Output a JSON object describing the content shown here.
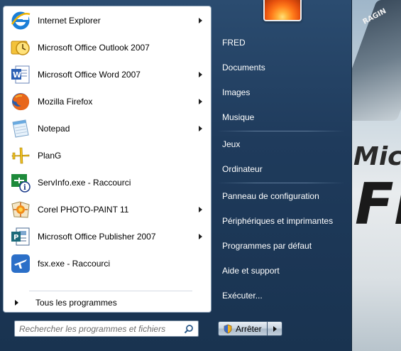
{
  "programs": [
    {
      "label": "Internet Explorer",
      "icon": "internet-explorer-icon",
      "has_arrow": true
    },
    {
      "label": "Microsoft Office Outlook 2007",
      "icon": "outlook-icon",
      "has_arrow": false
    },
    {
      "label": "Microsoft Office Word 2007",
      "icon": "word-icon",
      "has_arrow": true
    },
    {
      "label": "Mozilla Firefox",
      "icon": "firefox-icon",
      "has_arrow": true
    },
    {
      "label": "Notepad",
      "icon": "notepad-icon",
      "has_arrow": true
    },
    {
      "label": "PlanG",
      "icon": "airplane-icon",
      "has_arrow": false
    },
    {
      "label": "ServInfo.exe - Raccourci",
      "icon": "servinfo-icon",
      "has_arrow": false
    },
    {
      "label": "Corel PHOTO-PAINT 11",
      "icon": "corel-icon",
      "has_arrow": true
    },
    {
      "label": "Microsoft Office Publisher 2007",
      "icon": "publisher-icon",
      "has_arrow": true
    },
    {
      "label": "fsx.exe - Raccourci",
      "icon": "fsx-icon",
      "has_arrow": false
    }
  ],
  "all_programs_label": "Tous les programmes",
  "search": {
    "placeholder": "Rechercher les programmes et fichiers"
  },
  "right_panel": {
    "items": [
      {
        "label": "FRED"
      },
      {
        "label": "Documents"
      },
      {
        "label": "Images"
      },
      {
        "label": "Musique"
      },
      {
        "label": "Jeux"
      },
      {
        "label": "Ordinateur"
      },
      {
        "label": "Panneau de configuration"
      },
      {
        "label": "Périphériques et imprimantes"
      },
      {
        "label": "Programmes par défaut"
      },
      {
        "label": "Aide et support"
      },
      {
        "label": "Exécuter..."
      }
    ]
  },
  "shutdown": {
    "label": "Arrêter"
  },
  "wallpaper": {
    "plane_text": "RAGIN",
    "logo_line1": "Micr",
    "logo_line2": "Flig"
  },
  "colors": {
    "menu_background": "#1f3b5c",
    "left_panel": "#ffffff",
    "right_text": "#ffffff"
  }
}
